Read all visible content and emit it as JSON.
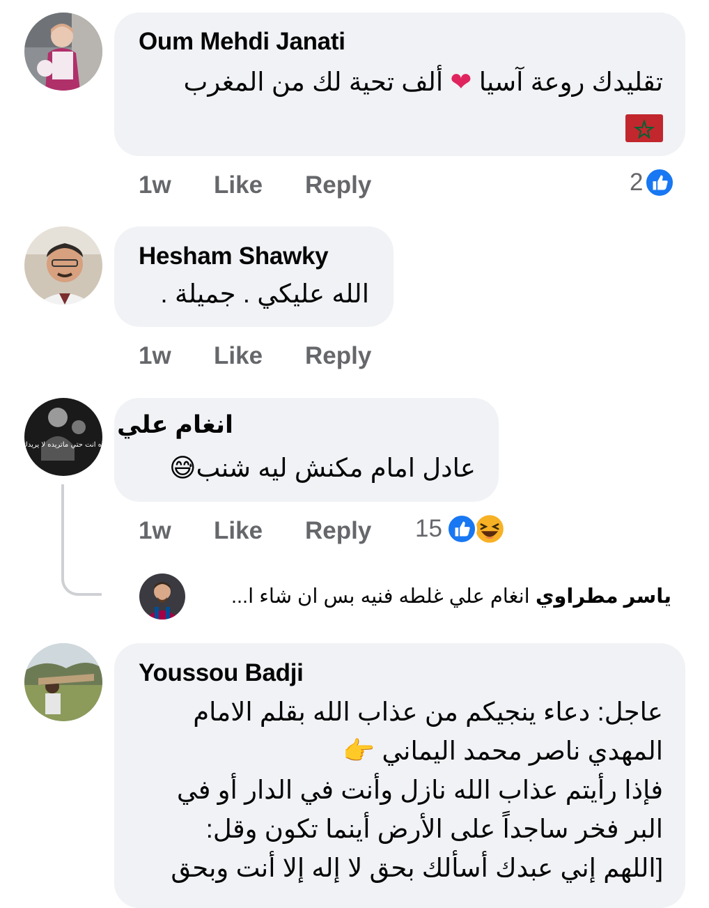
{
  "comments": [
    {
      "author": "Oum Mehdi Janati",
      "line1": "تقليدك روعة آسيا ❤️ ألف تحية لك من المغرب",
      "line2": "🇲🇦",
      "time": "1w",
      "like": "Like",
      "reply": "Reply",
      "reaction_count": "2"
    },
    {
      "author": "Hesham Shawky",
      "line1": "الله عليكي . جميلة .",
      "time": "1w",
      "like": "Like",
      "reply": "Reply"
    },
    {
      "author": "انغام علي",
      "line1": "عادل امام مكنش ليه شنب😅",
      "time": "1w",
      "like": "Like",
      "reply": "Reply",
      "reaction_count": "15",
      "avatar_caption": "ده انت حتي ماتريده لا يريدك",
      "reply_preview": {
        "author": "ياسر مطراوي",
        "snippet": "انغام علي غلطه فنيه بس ان شاء ا..."
      }
    },
    {
      "author": "Youssou Badji",
      "lines": [
        "عاجل: دعاء ينجيكم من عذاب الله بقلم الامام",
        "المهدي ناصر محمد اليماني 👉",
        "فإذا رأيتم عذاب الله نازل وأنت في الدار أو في",
        "البر فخر ساجداً على الأرض أينما تكون وقل:",
        "[اللهم إني عبدك أسألك بحق لا إله إلا أنت وبحق"
      ]
    }
  ],
  "colors": {
    "bubble": "#f0f2f5",
    "meta": "#65676b",
    "like_blue": "#1877f2"
  },
  "icons": [
    "heart-emoji",
    "morocco-flag",
    "like-reaction-icon",
    "haha-reaction-icon",
    "sweat-smile-emoji",
    "point-left-emoji"
  ]
}
